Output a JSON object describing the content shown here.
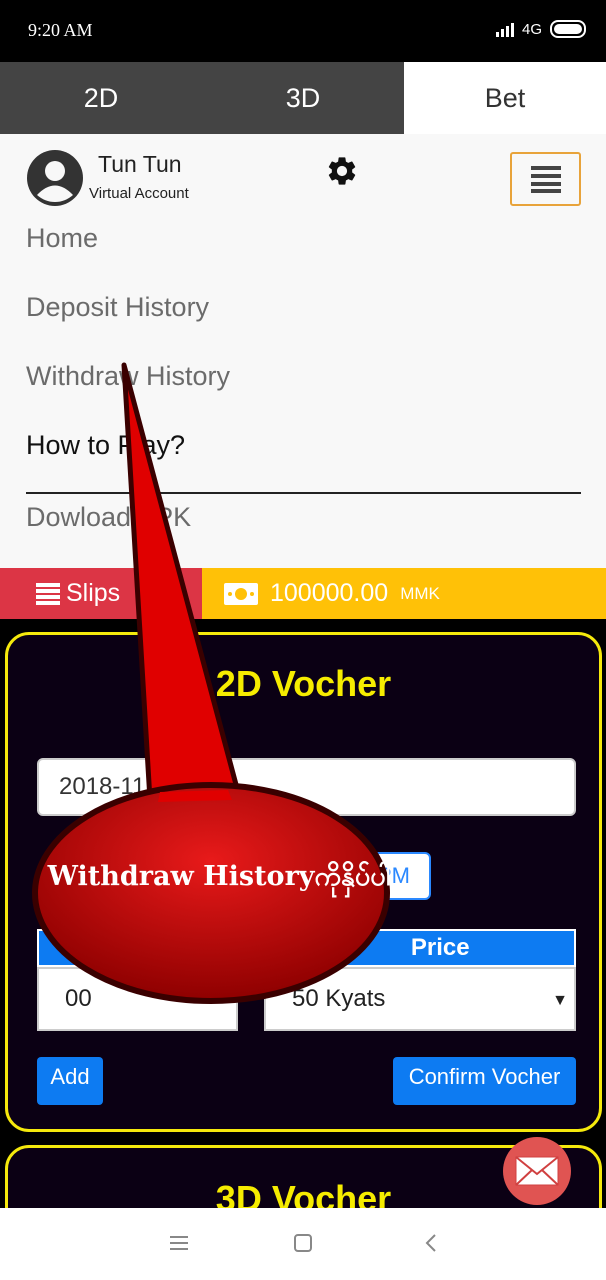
{
  "status_bar": {
    "time": "9:20 AM",
    "network": "4G"
  },
  "tabs": [
    {
      "label": "2D"
    },
    {
      "label": "3D"
    },
    {
      "label": "Bet"
    }
  ],
  "user": {
    "name": "Tun Tun",
    "account_type": "Virtual Account"
  },
  "menu": {
    "items": [
      {
        "label": "Home"
      },
      {
        "label": "Deposit History"
      },
      {
        "label": "Withdraw History"
      },
      {
        "label": "How to Play?"
      },
      {
        "label": "Dowload APK"
      }
    ]
  },
  "wallet": {
    "slips_label": "Slips",
    "balance": "100000.00",
    "currency": "MMK"
  },
  "vocher_2d": {
    "title": "2D Vocher",
    "date": "2018-11",
    "time_option": "PM",
    "table": {
      "headers": [
        "Number",
        "Price"
      ],
      "rows": [
        {
          "number": "00",
          "price": "50 Kyats"
        }
      ]
    },
    "add_label": "Add",
    "confirm_label": "Confirm Vocher"
  },
  "vocher_3d": {
    "title": "3D Vocher"
  },
  "callout": {
    "text": "Withdraw Historyကိုနှိပ်ပါ",
    "color": "#c81010"
  },
  "colors": {
    "accent_blue": "#0d7bf2",
    "slips_red": "#dc3545",
    "balance_yellow": "#ffc107",
    "card_border": "#f5e90c"
  }
}
